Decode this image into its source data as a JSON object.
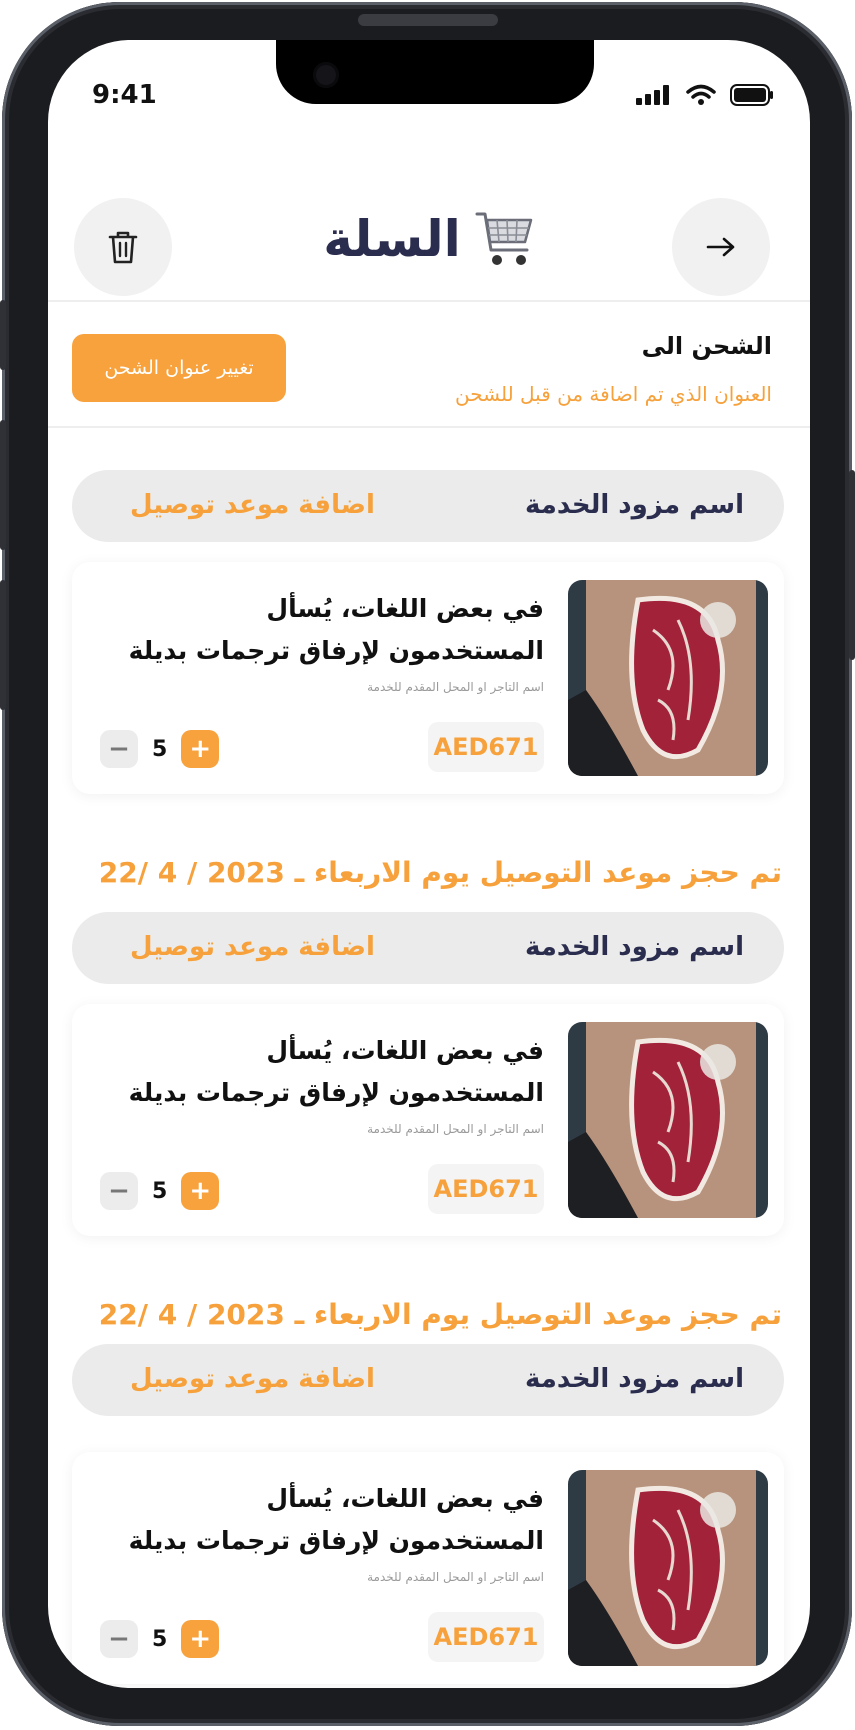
{
  "status": {
    "time": "9:41"
  },
  "header": {
    "title": "السلة",
    "cart_icon": "shopping-cart-icon",
    "back_icon": "arrow-right-icon",
    "delete_icon": "trash-icon"
  },
  "shipping": {
    "label": "الشحن الى",
    "address_text": "العنوان الذي تم اضافة من قبل للشحن",
    "change_button": "تغيير عنوان الشحن"
  },
  "colors": {
    "accent": "#f7a23c",
    "title": "#2b2d4e",
    "bar": "#ebebeb"
  },
  "groups": [
    {
      "provider": "اسم مزود الخدمة",
      "schedule_button": "اضافة موعد توصيل",
      "product": {
        "title": "في بعض اللغات، يُسأل المستخدمون لإرفاق ترجمات بديلة",
        "merchant": "اسم التاجر او المحل المقدم للخدمة",
        "price": "AED671",
        "qty": "5"
      },
      "booked": "تم حجز موعد التوصيل يوم الاربعاء ـ 2023 / 4 /22"
    },
    {
      "provider": "اسم مزود الخدمة",
      "schedule_button": "اضافة موعد توصيل",
      "product": {
        "title": "في بعض اللغات، يُسأل المستخدمون لإرفاق ترجمات بديلة",
        "merchant": "اسم التاجر او المحل المقدم للخدمة",
        "price": "AED671",
        "qty": "5"
      },
      "booked": "تم حجز موعد التوصيل يوم الاربعاء ـ 2023 / 4 /22"
    },
    {
      "provider": "اسم مزود الخدمة",
      "schedule_button": "اضافة موعد توصيل",
      "product": {
        "title": "في بعض اللغات، يُسأل المستخدمون لإرفاق ترجمات بديلة",
        "merchant": "اسم التاجر او المحل المقدم للخدمة",
        "price": "AED671",
        "qty": "5"
      }
    }
  ]
}
